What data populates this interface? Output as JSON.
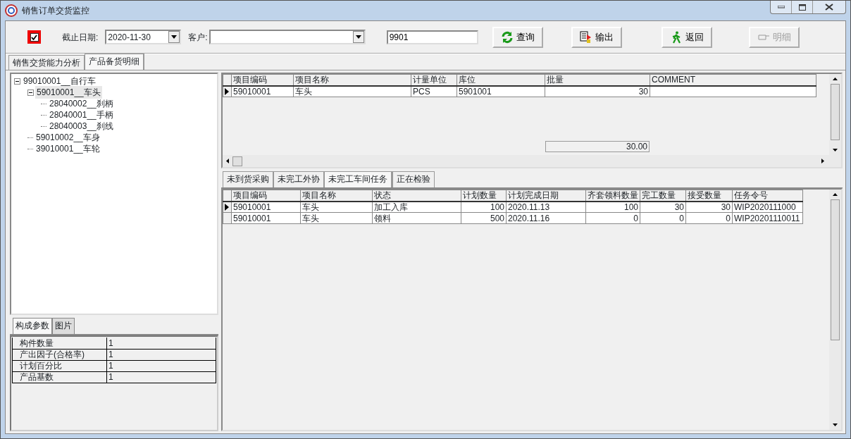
{
  "window": {
    "title": "销售订单交货监控"
  },
  "toolbar": {
    "filter_checkbox": {
      "checked": true
    },
    "date_label": "截止日期:",
    "date_value": "2020-11-30",
    "customer_label": "客户:",
    "code_value": "9901",
    "buttons": [
      {
        "label": "查询",
        "kind": "refresh",
        "disabled": false
      },
      {
        "label": "输出",
        "kind": "export",
        "disabled": false
      },
      {
        "label": "返回",
        "kind": "back",
        "disabled": false
      },
      {
        "label": "明细",
        "kind": "detail",
        "disabled": true
      }
    ]
  },
  "tabs": [
    {
      "label": "销售交货能力分析",
      "selected": false
    },
    {
      "label": "产品备货明细",
      "selected": true
    }
  ],
  "tree": [
    {
      "label": "99010001__自行车",
      "expanded": true,
      "selected": false,
      "children": [
        {
          "label": "59010001__车头",
          "expanded": true,
          "selected": true,
          "children": [
            {
              "label": "28040002__刹柄",
              "selected": false
            },
            {
              "label": "28040001__手柄",
              "selected": false
            },
            {
              "label": "28040003__刹线",
              "selected": false
            }
          ]
        },
        {
          "label": "59010002__车身",
          "selected": false
        },
        {
          "label": "39010001__车轮",
          "selected": false
        }
      ]
    }
  ],
  "param_tabs": [
    {
      "label": "构成参数",
      "selected": true
    },
    {
      "label": "图片",
      "selected": false
    }
  ],
  "params": [
    {
      "name": "构件数量",
      "value": "1"
    },
    {
      "name": "产出因子(合格率)",
      "value": "1"
    },
    {
      "name": "计划百分比",
      "value": "1"
    },
    {
      "name": "产品基数",
      "value": "1"
    }
  ],
  "stock_grid": {
    "columns": [
      {
        "label": "项目编码",
        "numeric": false
      },
      {
        "label": "项目名称",
        "numeric": false
      },
      {
        "label": "计量单位",
        "numeric": false
      },
      {
        "label": "库位",
        "numeric": false
      },
      {
        "label": "批量",
        "numeric": true
      },
      {
        "label": "COMMENT"
      }
    ],
    "rows": [
      {
        "selected": true,
        "cells": [
          "59010001",
          "车头",
          "PCS",
          "5901001",
          "30",
          ""
        ]
      }
    ],
    "total": "30.00"
  },
  "task_tabs": [
    {
      "label": "未到货采购",
      "selected": false
    },
    {
      "label": "未完工外协",
      "selected": false
    },
    {
      "label": "未完工车间任务",
      "selected": true
    },
    {
      "label": "正在检验",
      "selected": false
    }
  ],
  "task_grid": {
    "columns": [
      {
        "label": "项目编码",
        "numeric": false
      },
      {
        "label": "项目名称",
        "numeric": false
      },
      {
        "label": "状态",
        "numeric": false
      },
      {
        "label": "计划数量",
        "numeric": true
      },
      {
        "label": "计划完成日期",
        "numeric": false
      },
      {
        "label": "齐套领料数量",
        "numeric": true
      },
      {
        "label": "完工数量",
        "numeric": true
      },
      {
        "label": "接受数量",
        "numeric": true
      },
      {
        "label": "任务令号",
        "numeric": false
      }
    ],
    "rows": [
      {
        "selected": true,
        "cells": [
          "59010001",
          "车头",
          "加工入库",
          "100",
          "2020.11.13",
          "100",
          "30",
          "30",
          "WIP2020111000"
        ]
      },
      {
        "selected": false,
        "cells": [
          "59010001",
          "车头",
          "领料",
          "500",
          "2020.11.16",
          "0",
          "0",
          "0",
          "WIP20201110011"
        ]
      }
    ]
  }
}
